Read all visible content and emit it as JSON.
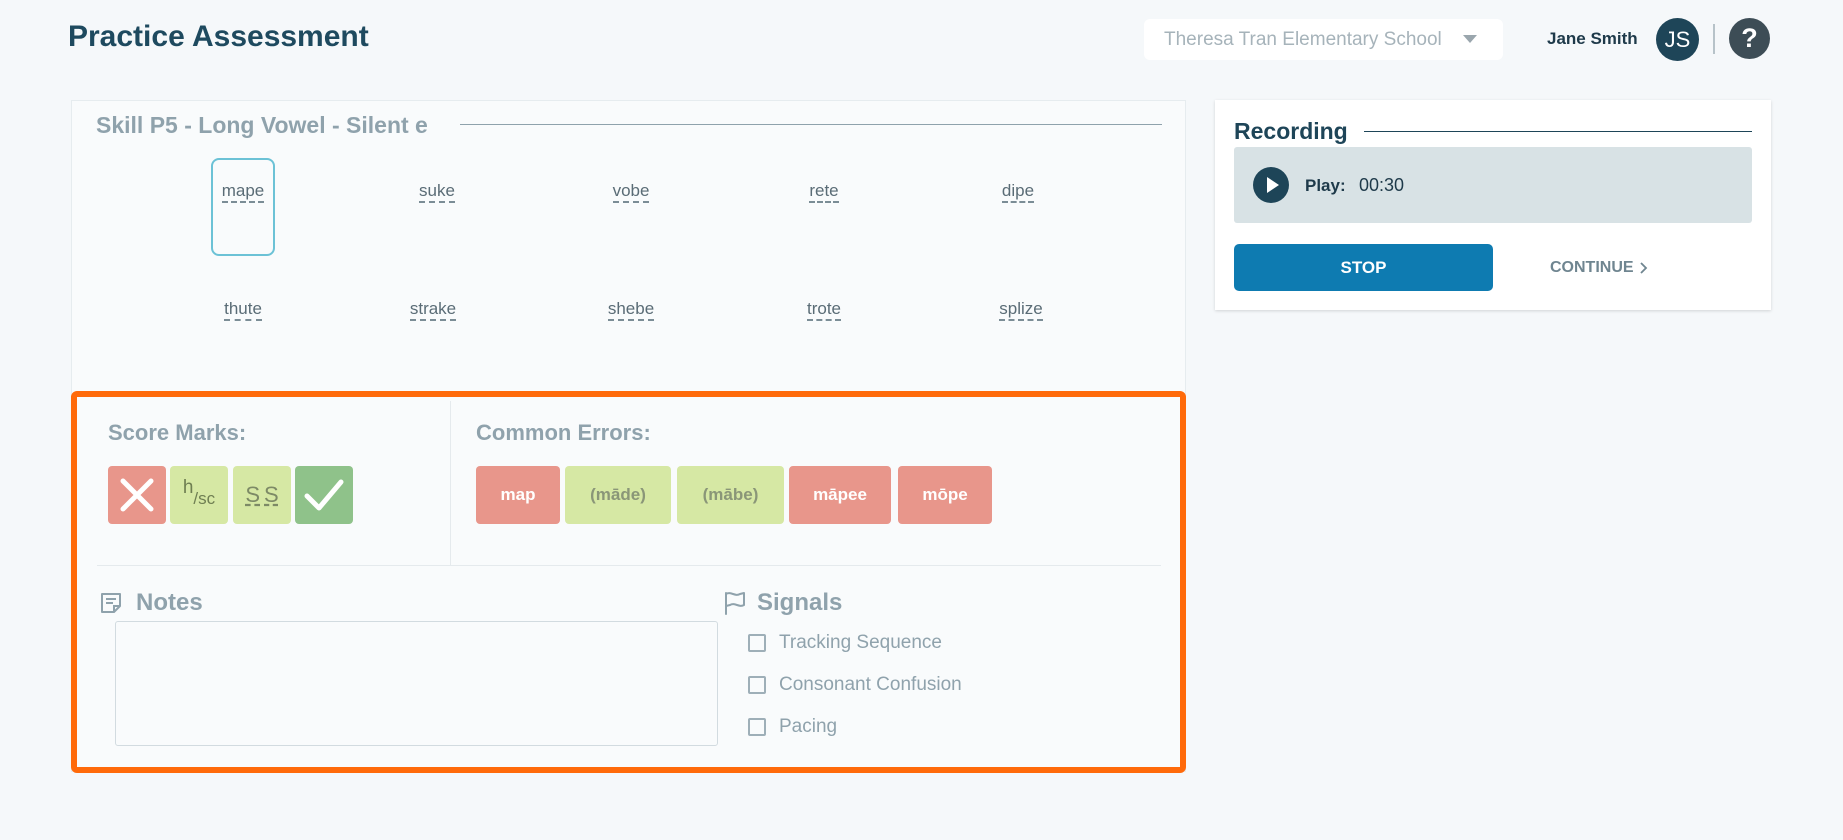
{
  "header": {
    "title": "Practice Assessment",
    "school_select": "Theresa Tran Elementary School",
    "user_name": "Jane Smith",
    "avatar_initials": "JS",
    "help_symbol": "?"
  },
  "skill": {
    "title": "Skill P5 - Long Vowel - Silent e",
    "words": [
      "mape",
      "suke",
      "vobe",
      "rete",
      "dipe",
      "thute",
      "strake",
      "shebe",
      "trote",
      "splize"
    ],
    "selected_word": "mape"
  },
  "score_marks": {
    "label": "Score Marks:",
    "hsc_h": "h",
    "hsc_sc": "/sc",
    "ss_left": "S",
    "ss_right": "S",
    "icons": [
      "x-icon",
      "check-icon"
    ]
  },
  "common_errors": {
    "label": "Common Errors:",
    "items": [
      "map",
      "(māde)",
      "(mābe)",
      "māpee",
      "mōpe"
    ]
  },
  "notes": {
    "label": "Notes",
    "value": ""
  },
  "signals": {
    "label": "Signals",
    "items": [
      "Tracking Sequence",
      "Consonant Confusion",
      "Pacing"
    ]
  },
  "recording": {
    "title": "Recording",
    "play_label": "Play:",
    "time": "00:30",
    "stop_label": "STOP",
    "continue_label": "CONTINUE"
  },
  "colors": {
    "highlight": "#ff6a0a",
    "primary": "#0e7bb1",
    "error_red": "#e8968b",
    "light_green": "#d6e8a4",
    "correct_green": "#8fc28a"
  }
}
